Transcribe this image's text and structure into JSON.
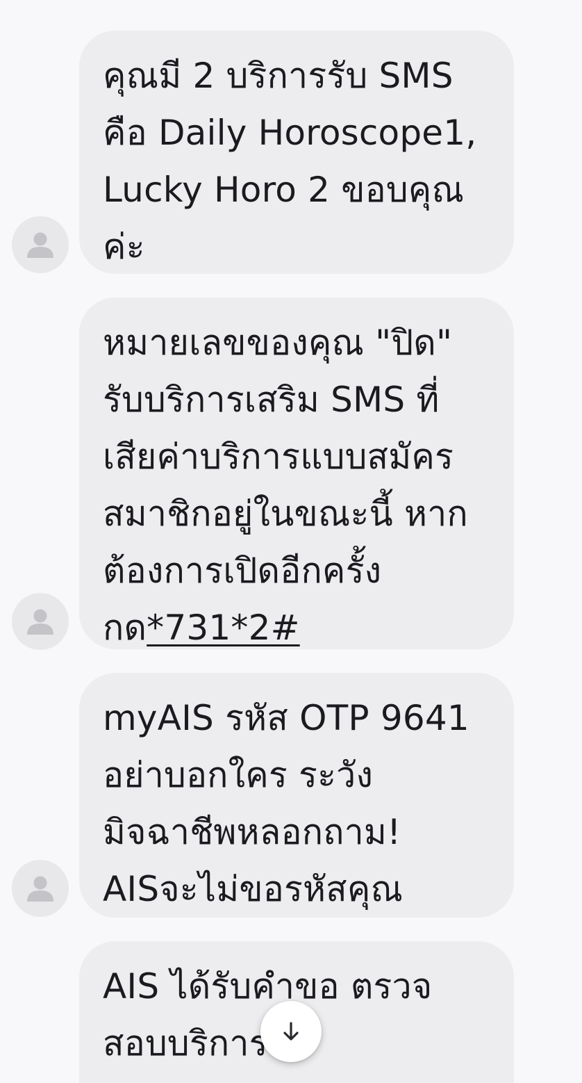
{
  "messages": [
    {
      "text": "คุณมี 2 บริการรับ SMS คือ Daily Horoscope1, Lucky Horo 2 ขอบคุณค่ะ"
    },
    {
      "text_before_link": "หมายเลขของคุณ \"ปิด\" รับบริการเสริม SMS ที่เสียค่าบริการแบบสมัครสมาชิกอยู่ในขณะนี้ หากต้องการเปิดอีกครั้ง กด",
      "link": "*731*2#"
    },
    {
      "text": "myAIS รหัส OTP 9641 อย่าบอกใคร ระวัง มิจฉาชีพหลอกถาม! AISจะไม่ขอรหัสคุณ"
    },
    {
      "text": "AIS ได้รับคำขอ ตรวจสอบบริการ"
    }
  ],
  "icons": {
    "avatar": "person-icon",
    "scroll_button": "arrow-down-icon"
  },
  "colors": {
    "background": "#f8f8fa",
    "bubble": "#ededf0",
    "text": "#1b1b1f",
    "avatar_bg": "#e8e8eb",
    "avatar_glyph": "#c4c4c8"
  }
}
